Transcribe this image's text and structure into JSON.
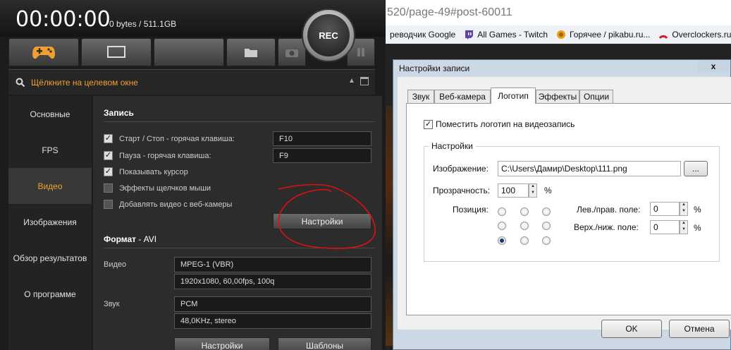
{
  "bandicam": {
    "timer": "00:00:00",
    "size_info": "0 bytes / 511.1GB",
    "rec_label": "REC",
    "target_label": "Щёлкните на целевом окне",
    "sidebar": [
      {
        "label": "Основные"
      },
      {
        "label": "FPS"
      },
      {
        "label": "Видео",
        "active": true
      },
      {
        "label": "Изображения"
      },
      {
        "label": "Обзор результатов"
      },
      {
        "label": "О программе"
      }
    ],
    "record": {
      "title": "Запись",
      "start_stop_label": "Старт / Стоп - горячая клавиша:",
      "start_stop_key": "F10",
      "pause_label": "Пауза - горячая клавиша:",
      "pause_key": "F9",
      "show_cursor_label": "Показывать курсор",
      "click_effects_label": "Эффекты щелчков мыши",
      "webcam_label": "Добавлять видео с веб-камеры",
      "settings_button": "Настройки"
    },
    "format": {
      "title": "Формат",
      "container": " - AVI",
      "video_label": "Видео",
      "video_codec": "MPEG-1 (VBR)",
      "video_params": "1920x1080, 60,00fps, 100q",
      "audio_label": "Звук",
      "audio_codec": "PCM",
      "audio_params": "48,0KHz, stereo",
      "settings_button": "Настройки",
      "templates_button": "Шаблоны"
    }
  },
  "browser": {
    "url_fragment": "520/page-49#post-60011",
    "bookmarks": [
      {
        "label": "реводчик Google",
        "icon": "google-translate-icon"
      },
      {
        "label": "All Games - Twitch",
        "icon": "twitch-icon"
      },
      {
        "label": "Горячее / pikabu.ru...",
        "icon": "pikabu-icon"
      },
      {
        "label": "Overclockers.ru",
        "icon": "overclockers-icon"
      }
    ]
  },
  "dialog": {
    "title": "Настройки записи",
    "close_label": "x",
    "tabs": [
      {
        "label": "Звук"
      },
      {
        "label": "Веб-камера"
      },
      {
        "label": "Логотип",
        "active": true
      },
      {
        "label": "Эффекты"
      },
      {
        "label": "Опции"
      }
    ],
    "logo_checkbox_label": "Поместить логотип на видеозапись",
    "group_title": "Настройки",
    "image_label": "Изображение:",
    "image_path": "C:\\Users\\Дамир\\Desktop\\111.png",
    "browse_label": "...",
    "opacity_label": "Прозрачность:",
    "opacity_value": "100",
    "percent": "%",
    "position_label": "Позиция:",
    "selected_position": "bottom-left",
    "hmargin_label": "Лев./прав. поле:",
    "hmargin_value": "0",
    "vmargin_label": "Верх./ниж. поле:",
    "vmargin_value": "0",
    "ok_label": "OK",
    "cancel_label": "Отмена"
  },
  "colors": {
    "accent_orange": "#f0a030",
    "annotation_red": "#e01010"
  }
}
